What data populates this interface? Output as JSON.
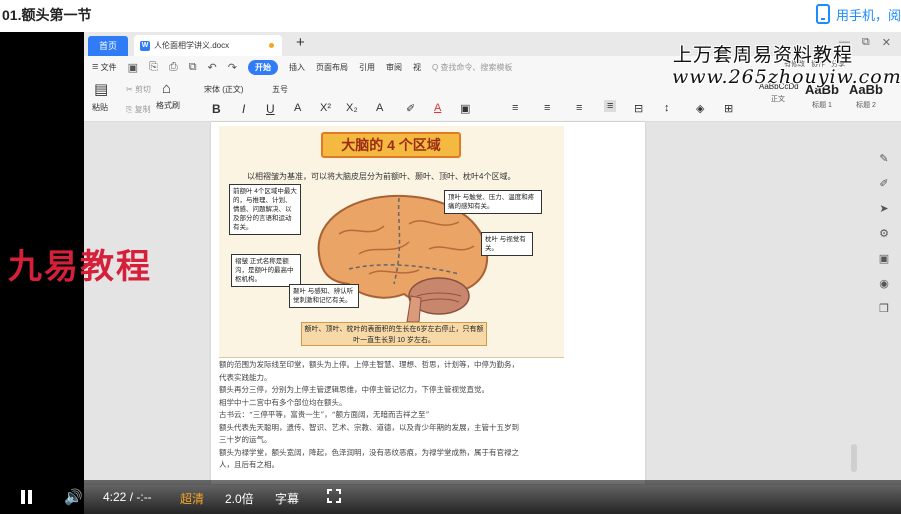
{
  "page": {
    "title": "01.额头第一节",
    "phone_link": "用手机，阅"
  },
  "video": {
    "brand_overlay": "九易教程"
  },
  "wps": {
    "tabs": {
      "home": "首页",
      "doc": "人伦面相学讲义.docx",
      "doc_icon": "W"
    },
    "menu": [
      "文件",
      "开始",
      "插入",
      "页面布局",
      "引用",
      "审阅",
      "视",
      "Q 查找命令、搜索模板"
    ],
    "right_links": [
      "有修改",
      "协作",
      "分享"
    ],
    "ribbon": {
      "paste": "粘贴",
      "cut": "剪切",
      "copy": "复制",
      "format_painter": "格式刷",
      "font": "宋体 (正文)",
      "size": "五号",
      "styles": [
        {
          "preview": "AaBbCcDd",
          "name": "正文"
        },
        {
          "preview": "AaBb",
          "name": "标题 1"
        },
        {
          "preview": "AaBb",
          "name": "标题 2"
        }
      ]
    },
    "figure": {
      "title": "大脑的 4 个区域",
      "caption": "以相褶皱为基准，可以将大脑皮层分为前额叶、颞叶、顶叶、枕叶4个区域。",
      "callouts": {
        "frontal": "前额叶 4个区域中最大的，与推理、计划、情感、问题解决、以及部分的言语和运动有关。",
        "parietal": "顶叶 与触觉、压力、温度和疼痛的感知有关。",
        "occipital": "枕叶 与视觉有关。",
        "motor": "褶皱 正式名称是额沟，是额叶的最高中枢机构。",
        "temporal": "颞叶 与感知、辨认听觉刺激和记忆有关。"
      },
      "footer": "额叶、顶叶、枕叶的表面积的生长在6岁左右停止，只有额叶一直生长到 10 岁左右。"
    },
    "body_lines": [
      "额的范围为发际线至印堂，额头为上停。上停主智慧、理想、哲思，计划等，中停为勤务，",
      "代表实践能力。",
      "额头再分三停，分别为上停主管逻辑思维，中停主管记忆力，下停主管视觉直觉。",
      "相学中十二宫中有多个部位均在额头。",
      "古书云：“三停平等，富贵一生”，“额方面阔，无暗而吉祥之至”",
      "额头代表先天聪明，遗传、智识、艺术、宗教、道德，以及青少年期的发展，主管十五岁到",
      "三十岁的运气。",
      "额头为禄学堂，额头宽阔，降起，色泽润明，没有恶纹恶痕，为禄学堂成熟，属于有官禄之",
      "人，且后有之相。"
    ],
    "watermark": {
      "line1": "上万套周易资料教程",
      "line2": "www.265zhouyiw.com"
    }
  },
  "player": {
    "time": "4:22 / -:--",
    "quality": "超清",
    "speed": "2.0倍",
    "subtitles": "字幕"
  }
}
